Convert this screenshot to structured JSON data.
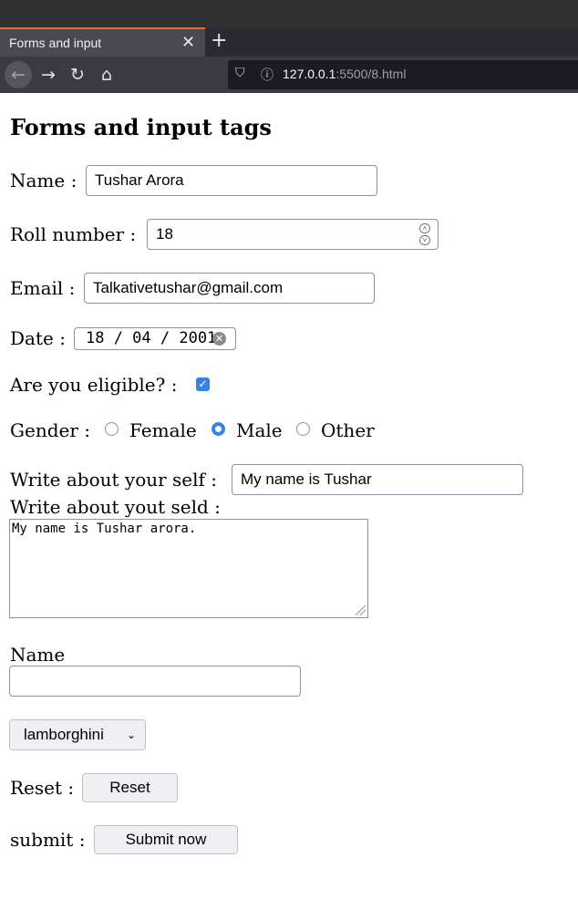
{
  "browser": {
    "tab_title": "Forms and input",
    "tab_close": "✕",
    "new_tab": "+",
    "url_host": "127.0.0.1",
    "url_rest": ":5500/8.html"
  },
  "page": {
    "heading": "Forms and input tags",
    "name_label": "Name :",
    "name_value": "Tushar Arora",
    "roll_label": "Roll number :",
    "roll_value": "18",
    "email_label": "Email :",
    "email_value": "Talkativetushar@gmail.com",
    "date_label": "Date :",
    "date_value": "18 / 04 / 2001",
    "eligible_label": "Are you eligible? :",
    "eligible_checked": true,
    "gender_label": "Gender :",
    "gender_options": [
      "Female",
      "Male",
      "Other"
    ],
    "gender_selected": "Male",
    "about_label": "Write about your self :",
    "about_value": "My name is Tushar",
    "about2_label": "Write about yout seld :",
    "about2_value": "My name is Tushar arora.",
    "name2_label": "Name",
    "name2_value": "",
    "select_value": "lamborghini",
    "reset_label": "Reset :",
    "reset_button": "Reset",
    "submit_label": "submit :",
    "submit_button": "Submit now"
  },
  "colors": {
    "accent": "#3584e4",
    "tab_highlight": "#e66a2c"
  }
}
